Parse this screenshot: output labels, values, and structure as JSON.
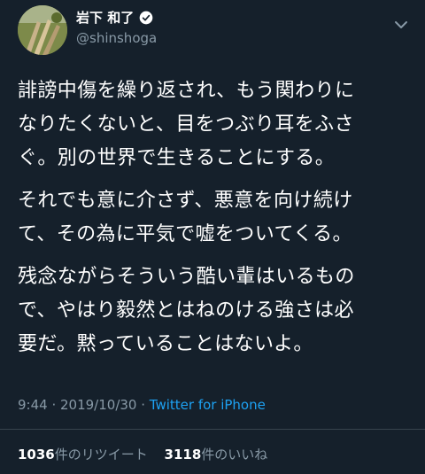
{
  "user": {
    "display_name": "岩下 和了",
    "handle": "@shinshoga"
  },
  "tweet": {
    "paragraphs": [
      "誹謗中傷を繰り返され、もう関わりに\nなりたくないと、目をつぶり耳をふさ\nぐ。別の世界で生きることにする。",
      "それでも意に介さず、悪意を向け続け\nて、その為に平気で嘘をついてくる。",
      "残念ながらそういう酷い輩はいるもの\nで、やはり毅然とはねのける強さは必\n要だ。黙っていることはないよ。"
    ]
  },
  "meta": {
    "time": "9:44",
    "sep": " · ",
    "date": "2019/10/30",
    "source": "Twitter for iPhone"
  },
  "stats": {
    "retweets_count": "1036",
    "retweets_label": "件のリツイート",
    "likes_count": "3118",
    "likes_label": "件のいいね"
  },
  "colors": {
    "background": "#15202b",
    "secondary_text": "#8899a6",
    "link": "#1da1f2"
  },
  "icons": {
    "verified": "verified-badge-icon",
    "more": "chevron-down-icon"
  }
}
